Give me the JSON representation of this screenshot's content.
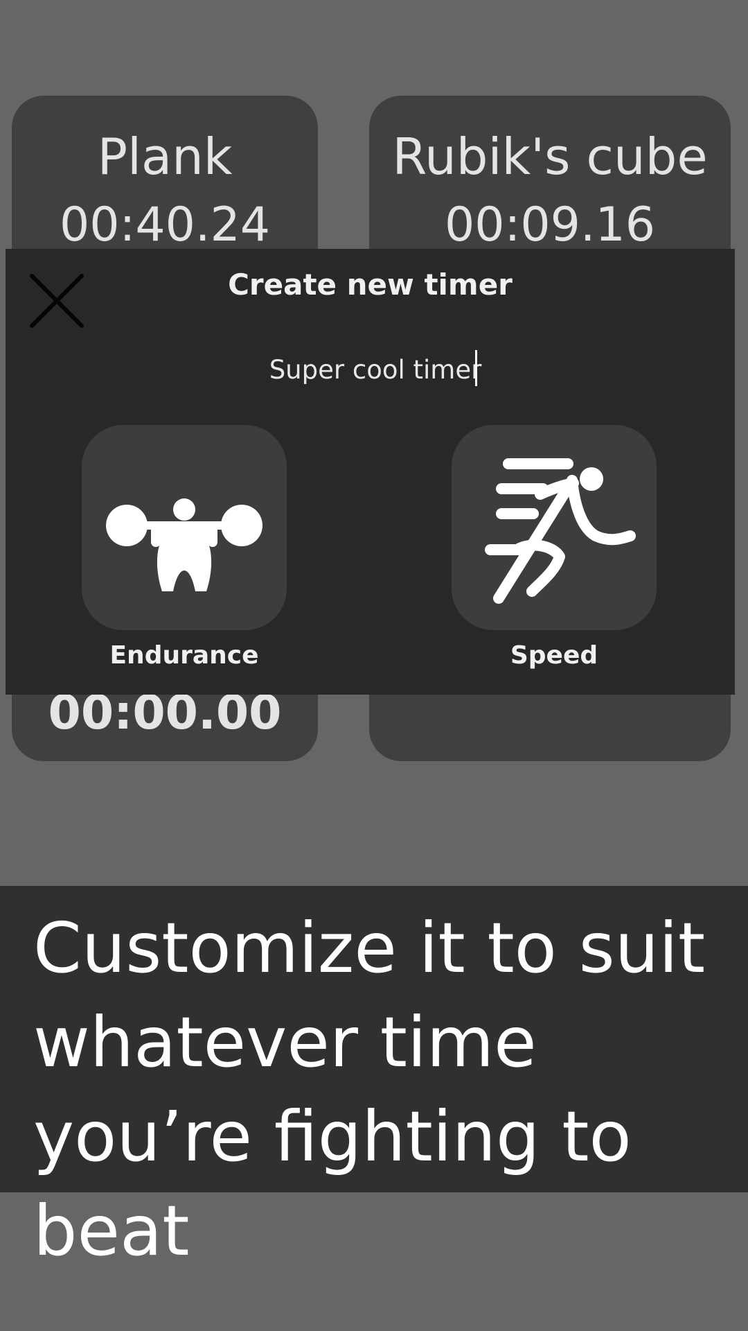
{
  "cards": [
    {
      "title": "Plank",
      "time": "00:40.24",
      "bottom_time": "00:00.00"
    },
    {
      "title": "Rubik's cube",
      "time": "00:09.16"
    }
  ],
  "dialog": {
    "title": "Create new timer",
    "close_icon": "close-icon",
    "name_value": "Super cool timer",
    "types": [
      {
        "label": "Endurance",
        "icon": "weightlifter-icon"
      },
      {
        "label": "Speed",
        "icon": "runner-icon"
      }
    ]
  },
  "banner": {
    "text": "Customize it to suit whatever time you’re fighting to beat"
  },
  "colors": {
    "background": "#666666",
    "card": "#404040",
    "dialog": "#282828",
    "tile": "#3d3d3d",
    "banner": "#303030"
  }
}
